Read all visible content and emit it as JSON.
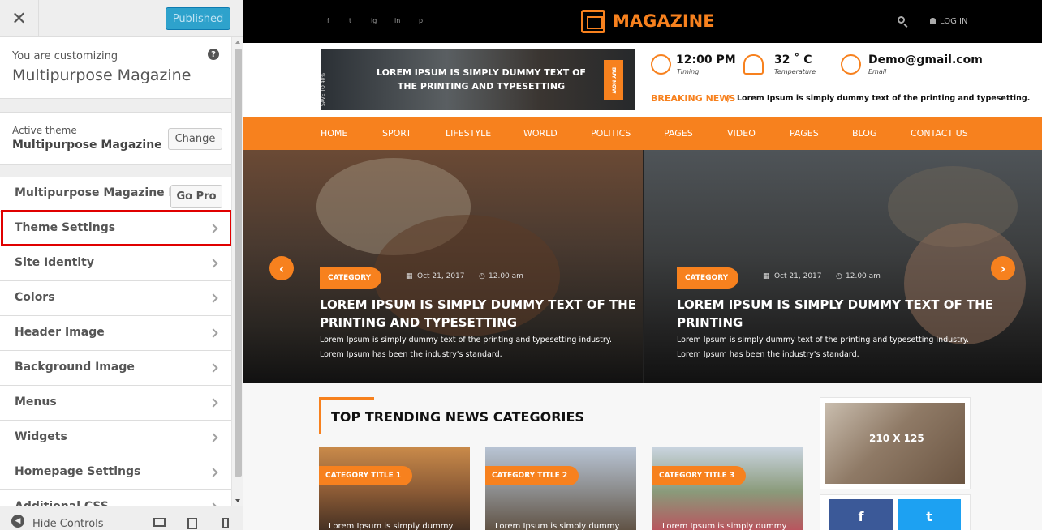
{
  "customizer": {
    "close_label": "✕",
    "publish_label": "Published",
    "info": {
      "label": "You are customizing",
      "title": "Multipurpose Magazine",
      "help": "?"
    },
    "active_theme": {
      "label": "Active theme",
      "name": "Multipurpose Magazine",
      "change_label": "Change"
    },
    "pro": {
      "label": "Multipurpose Magazine Pro",
      "button": "Go Pro"
    },
    "menu_items": [
      {
        "label": "Theme Settings",
        "highlighted": true
      },
      {
        "label": "Site Identity"
      },
      {
        "label": "Colors"
      },
      {
        "label": "Header Image"
      },
      {
        "label": "Background Image"
      },
      {
        "label": "Menus"
      },
      {
        "label": "Widgets"
      },
      {
        "label": "Homepage Settings"
      },
      {
        "label": "Additional CSS"
      }
    ],
    "footer": {
      "hide_label": "Hide Controls",
      "devices": [
        "desktop-icon",
        "tablet-icon",
        "mobile-icon"
      ]
    }
  },
  "site": {
    "social_icons": [
      "f",
      "t",
      "ig",
      "in",
      "p"
    ],
    "logo": "MAGAZINE",
    "login_label": "LOG IN",
    "banner": {
      "side_text": "SAVE TO 40%",
      "text": "LOREM IPSUM IS SIMPLY DUMMY TEXT OF THE PRINTING AND TYPESETTING",
      "buy_label": "BUY NOW"
    },
    "info": {
      "time": "12:00 PM",
      "time_label": "Timing",
      "temp": "32 ˚ C",
      "temp_label": "Temperature",
      "email": "Demo@gmail.com",
      "email_label": "Email"
    },
    "breaking": {
      "label": "BREAKING NEWS",
      "slash": "/",
      "text": "Lorem Ipsum is simply dummy text of the printing and typesetting."
    },
    "nav": [
      "HOME",
      "SPORT",
      "LIFESTYLE",
      "WORLD",
      "POLITICS",
      "PAGES",
      "VIDEO",
      "PAGES",
      "BLOG",
      "CONTACT US"
    ],
    "slides": [
      {
        "category": "CATEGORY",
        "date": "Oct 21, 2017",
        "time": "12.00 am",
        "title": "LOREM IPSUM IS SIMPLY DUMMY TEXT OF THE PRINTING AND TYPESETTING",
        "desc1": "Lorem Ipsum is simply dummy text of the printing and typesetting industry.",
        "desc2": "Lorem Ipsum has been the industry's standard."
      },
      {
        "category": "CATEGORY",
        "date": "Oct 21, 2017",
        "time": "12.00 am",
        "title": "LOREM IPSUM IS SIMPLY DUMMY TEXT OF THE PRINTING",
        "desc1": "Lorem Ipsum is simply dummy text of the printing and typesetting industry.",
        "desc2": "Lorem Ipsum has been the industry's standard."
      }
    ],
    "prev_arrow": "‹",
    "next_arrow": "›",
    "trending": {
      "title": "TOP TRENDING NEWS CATEGORIES",
      "cards": [
        {
          "category": "CATEGORY  TITLE 1",
          "text": "Lorem Ipsum is simply dummy"
        },
        {
          "category": "CATEGORY  TITLE 2",
          "text": "Lorem Ipsum is simply dummy"
        },
        {
          "category": "CATEGORY  TITLE 3",
          "text": "Lorem Ipsum is simply dummy"
        }
      ]
    },
    "sidebar_ad": "210 X 125",
    "social_buttons": [
      "f",
      "t"
    ]
  },
  "colors": {
    "accent": "#f7811e",
    "publish": "#2ea2cc",
    "highlight": "#e00000",
    "facebook": "#3b5998",
    "twitter": "#1da1f2"
  }
}
